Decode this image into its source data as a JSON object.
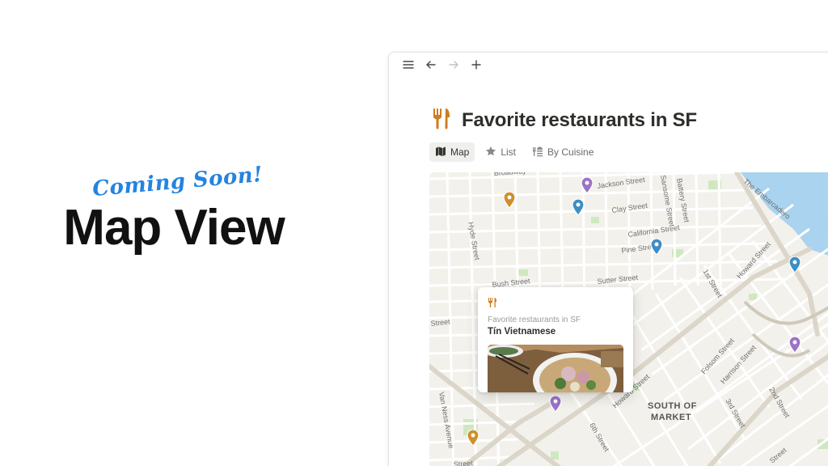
{
  "hero": {
    "coming_soon": "Coming Soon!",
    "title": "Map View"
  },
  "topbar": {
    "icons": [
      "menu-icon",
      "back-arrow-icon",
      "forward-arrow-icon",
      "plus-icon"
    ]
  },
  "page": {
    "icon": "fork-knife-icon",
    "title": "Favorite restaurants in SF"
  },
  "views": [
    {
      "label": "Map",
      "icon": "map-icon",
      "active": true
    },
    {
      "label": "List",
      "icon": "star-icon",
      "active": false
    },
    {
      "label": "By Cuisine",
      "icon": "cuisine-icon",
      "active": false
    }
  ],
  "map": {
    "streets": [
      "Broadway",
      "Jackson Street",
      "Sansome Street",
      "Battery Street",
      "The Embarcadero",
      "Clay Street",
      "Hyde Street",
      "California Street",
      "Pine Street",
      "1st Street",
      "Howard Street",
      "Bush Street",
      "Sutter Street",
      "Street",
      "Folsom Street",
      "Harrison Street",
      "Van Ness Avenue",
      "Howard Street",
      "2nd Street",
      "3rd Street",
      "6th Street",
      "Street"
    ],
    "district": [
      "SOUTH OF",
      "MARKET"
    ],
    "colors": {
      "water": "#a9d3ee",
      "park": "#cfe8c0",
      "land": "#f3f1ec",
      "road": "#ffffff",
      "arterial": "#dcd8cf",
      "pin_blue": "#3e8dc5",
      "pin_purple": "#9b73c7",
      "pin_gold": "#cf8f2a"
    }
  },
  "card": {
    "icon": "fork-knife-icon",
    "subtitle": "Favorite restaurants in SF",
    "title": "Tín Vietnamese",
    "image": "pho-bowl-photo"
  }
}
